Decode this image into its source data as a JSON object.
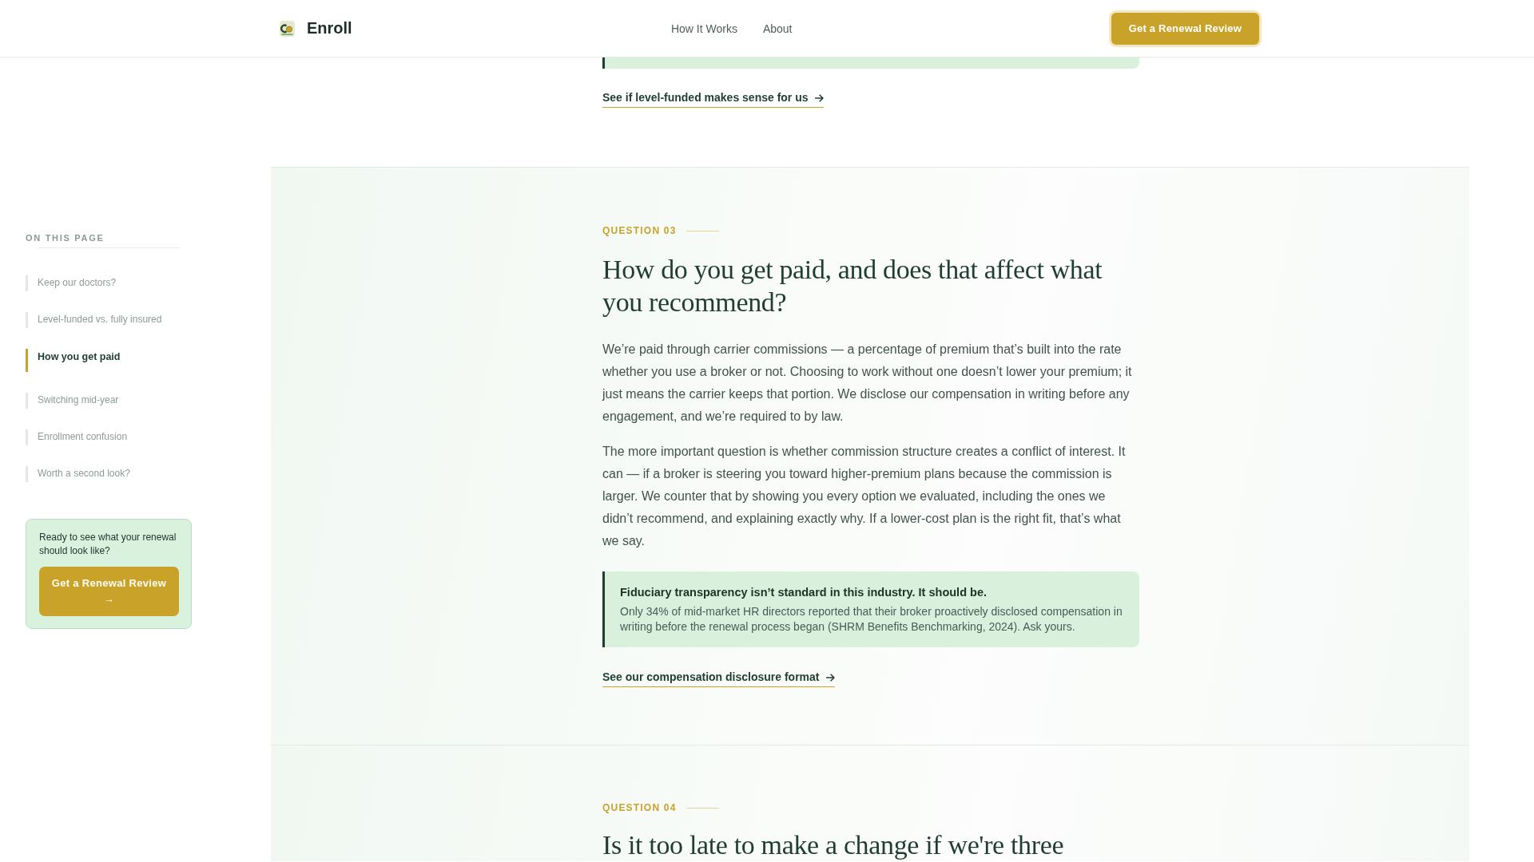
{
  "header": {
    "brand": "Enroll",
    "nav": [
      "How It Works",
      "About"
    ],
    "cta": "Get a Renewal Review"
  },
  "sidebar": {
    "title": "ON THIS PAGE",
    "items": [
      {
        "label": "Keep our doctors?",
        "selected": false
      },
      {
        "label": "Level-funded vs. fully insured",
        "selected": false
      },
      {
        "label": "How you get paid",
        "selected": true
      },
      {
        "label": "Switching mid-year",
        "selected": false
      },
      {
        "label": "Enrollment confusion",
        "selected": false
      },
      {
        "label": "Worth a second look?",
        "selected": false
      }
    ],
    "cta_card": {
      "text": "Ready to see what your renewal should look like?",
      "button": "Get a Renewal Review →"
    }
  },
  "sections": [
    {
      "kind": "continued",
      "link": "See if level-funded makes sense for us"
    },
    {
      "kind": "question",
      "label": "QUESTION 03",
      "heading": "How do you get paid, and does that affect what you recommend?",
      "paragraphs": [
        "We’re paid through carrier commissions — a percentage of premium that’s built into the rate whether you use a broker or not. Choosing to work without one doesn’t lower your premium; it just means the carrier keeps that portion. We disclose our compensation in writing before any engagement, and we’re required to by law.",
        "The more important question is whether commission structure creates a conflict of interest. It can — if a broker is steering you toward higher-premium plans because the commission is larger. We counter that by showing you every option we evaluated, including the ones we didn’t recommend, and explaining exactly why. If a lower-cost plan is the right fit, that’s what we say."
      ],
      "callout": {
        "title": "Fiduciary transparency isn’t standard in this industry. It should be.",
        "body": "Only 34% of mid-market HR directors reported that their broker proactively disclosed compensation in writing before the renewal process began (SHRM Benefits Benchmarking, 2024). Ask yours."
      },
      "link": "See our compensation disclosure format"
    },
    {
      "kind": "question",
      "label": "QUESTION 04",
      "heading": "Is it too late to make a change if we're three"
    }
  ]
}
